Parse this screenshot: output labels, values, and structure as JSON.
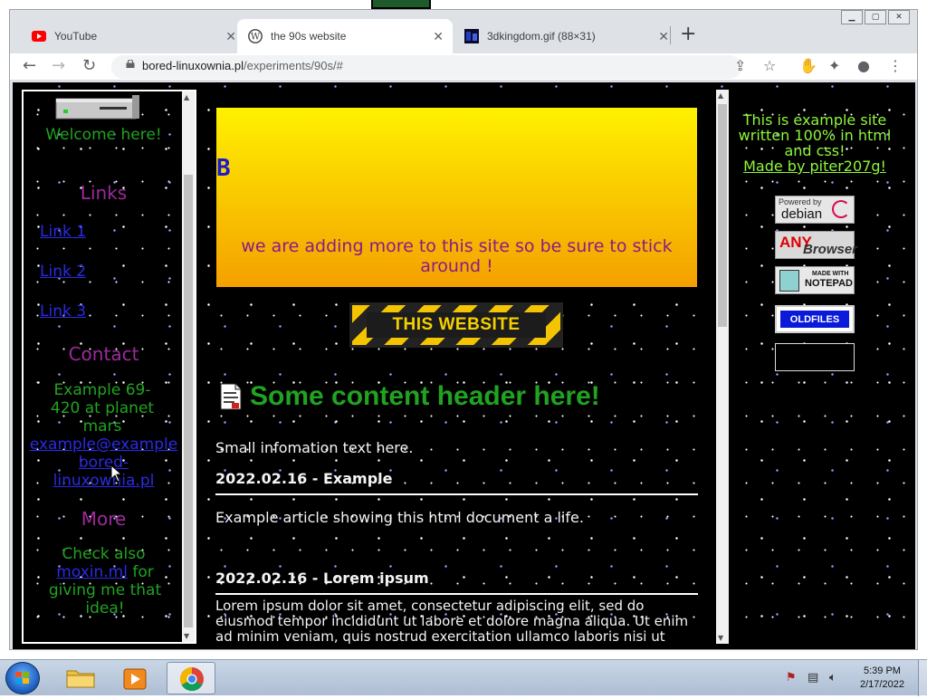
{
  "browser": {
    "tabs": [
      {
        "label": "YouTube",
        "icon": "youtube-icon"
      },
      {
        "label": "the 90s website",
        "icon": "wordpress-icon"
      },
      {
        "label": "3dkingdom.gif (88×31)",
        "icon": "gif-favicon-icon"
      }
    ],
    "url_host": "bored-linuxownia.pl",
    "url_path": "/experiments/90s/#"
  },
  "sidebar": {
    "welcome": "Welcome here!",
    "links_heading": "Links",
    "links": [
      "Link 1",
      "Link 2",
      "Link 3"
    ],
    "contact_heading": "Contact",
    "contact_address": "Example 69-420 at planet mars",
    "contact_email_1": "example@example",
    "contact_email_2": "bored-",
    "contact_email_3": "linuxownia.pl",
    "more_heading": "More",
    "more_prefix": "Check also",
    "more_link": "moxin.ml",
    "more_suffix": "for giving me that idea!"
  },
  "main": {
    "banner_letter": "B",
    "banner_message": "we are adding more to this site so be sure to stick around !",
    "hazard_text": "THIS WEBSITE",
    "content_header": "Some content header here!",
    "info": "Small infomation text here.",
    "articles": [
      {
        "title": "2022.02.16 - Example",
        "body": "Example article showing this html document a life."
      },
      {
        "title": "2022.02.16 - Lorem ipsum",
        "body": "Lorem ipsum dolor sit amet, consectetur adipiscing elit, sed do eiusmod tempor incididunt ut labore et dolore magna aliqua. Ut enim ad minim veniam, quis nostrud exercitation ullamco laboris nisi ut"
      }
    ]
  },
  "right": {
    "about": "This is example site written 100% in html and css!",
    "made_by": "Made by piter207g!",
    "badges": {
      "debian_small": "Powered by",
      "debian_big": "debian",
      "any_a": "ANY",
      "any_b": "Browser",
      "notepad_small": "MADE WITH",
      "notepad_big": "NOTEPAD",
      "oldfiles": "OLDFILES"
    }
  },
  "taskbar": {
    "time": "5:39 PM",
    "date": "2/17/2022"
  },
  "colors": {
    "green_text": "#21a321",
    "purple_text": "#9c2a9c",
    "link_blue": "#2a2ae6",
    "lime_text": "#8ef73a",
    "banner_top": "#fff100",
    "banner_bottom": "#f4a000"
  }
}
